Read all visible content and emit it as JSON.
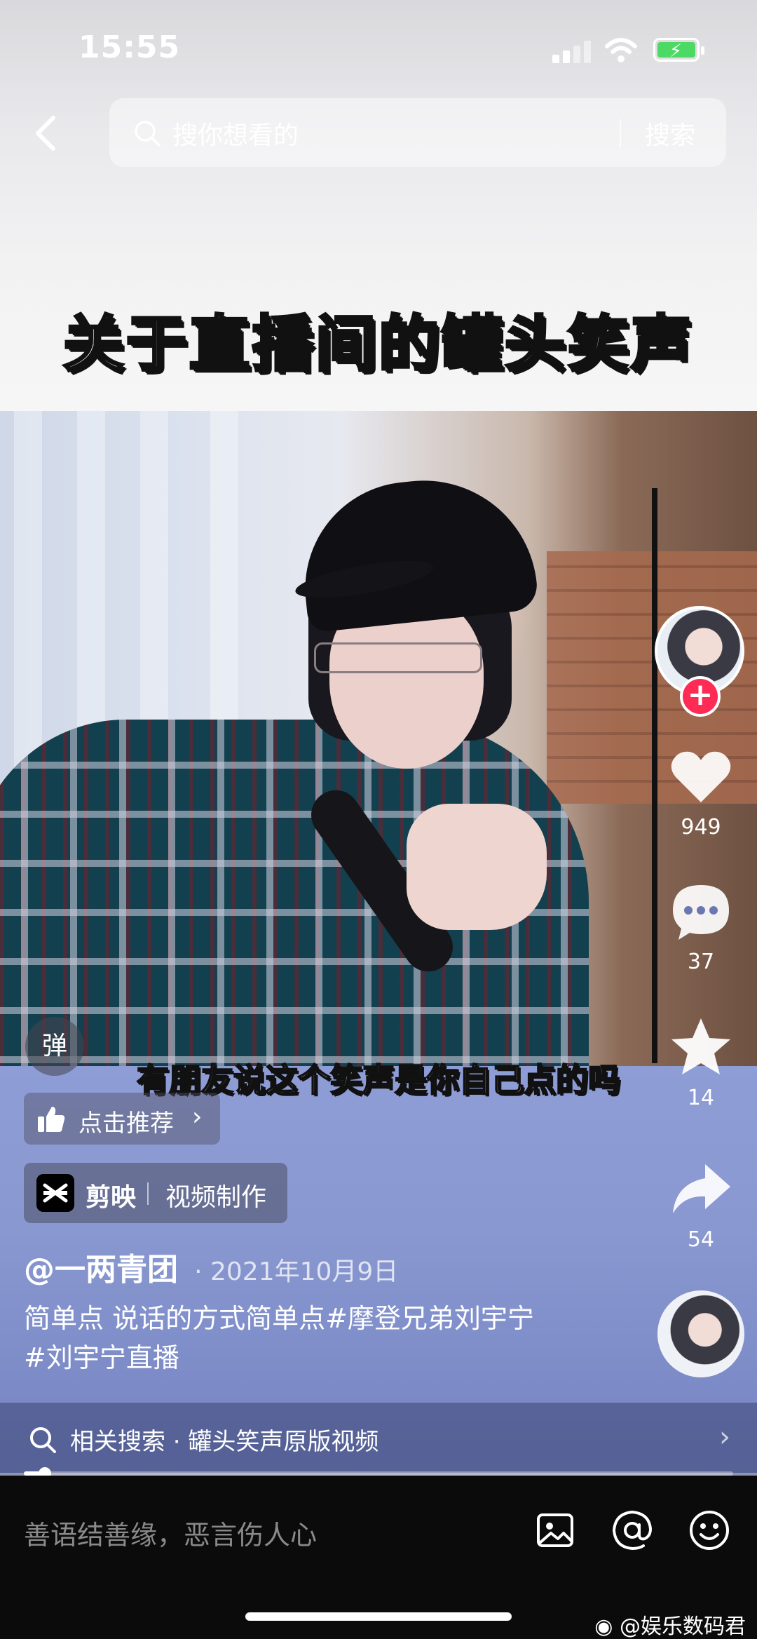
{
  "status_bar": {
    "time": "15:55",
    "battery": "charging"
  },
  "search": {
    "placeholder": "搜你想看的",
    "submit_label": "搜索"
  },
  "video": {
    "title": "关于直播间的罐头笑声",
    "subtitle": "有朋友说这个笑声是你自己点的吗"
  },
  "actions": {
    "danmaku_label": "弹",
    "recommend_label": "点击推荐",
    "capcut": {
      "name": "剪映",
      "desc": "视频制作"
    },
    "likes": "949",
    "comments": "37",
    "favorites": "14",
    "shares": "54"
  },
  "post": {
    "author": "@一两青团",
    "date": "· 2021年10月9日",
    "caption_line1": "简单点 说话的方式简单点#摩登兄弟刘宇宁",
    "caption_line2": "#刘宇宁直播"
  },
  "related": {
    "label": "相关搜索 · 罐头笑声原版视频"
  },
  "playback": {
    "progress": 0.03
  },
  "comment": {
    "placeholder": "善语结善缘，恶言伤人心"
  },
  "watermark": "@娱乐数码君",
  "colors": {
    "follow": "#fe2c55",
    "battery": "#4cd964",
    "panel": "#8f9dd6"
  },
  "icons": [
    "back-icon",
    "search-icon",
    "heart-icon",
    "comment-icon",
    "star-icon",
    "share-icon",
    "thumb-up-icon",
    "image-icon",
    "at-icon",
    "emoji-icon",
    "weibo-icon"
  ]
}
